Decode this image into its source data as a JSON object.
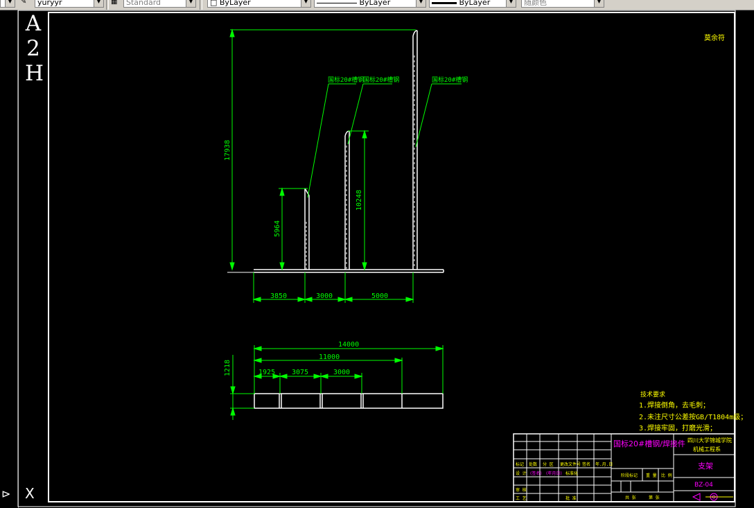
{
  "toolbar": {
    "layer_value": "yuryyr",
    "style_value": "Standard",
    "color_value": "ByLayer",
    "linetype_value": "ByLayer",
    "lineweight_value": "ByLayer",
    "plotstyle_value": "随颜色"
  },
  "sheet": {
    "side_letters": [
      "A",
      "2",
      "H"
    ],
    "bottom_mark": "X",
    "corner_note": "莫余符"
  },
  "elevation_view": {
    "leader_labels": [
      "国标20#槽钢",
      "国标20#槽钢",
      "国标20#槽钢"
    ],
    "dim_total_height": "17938",
    "dim_left_height": "5964",
    "dim_mid_height": "10248",
    "dim_spacing_1": "3850",
    "dim_spacing_2": "3000",
    "dim_spacing_3": "5000"
  },
  "plan_view": {
    "dim_overall": "14000",
    "dim_inner": "11000",
    "dim_a": "1925",
    "dim_b": "3075",
    "dim_c": "3000",
    "dim_depth": "1218"
  },
  "notes": {
    "title": "技术要求",
    "line1": "1.焊接倒角，去毛刺；",
    "line2": "2.未注尺寸公差按GB/T1804m级；",
    "line3": "3.焊接牢固，打磨光滑；"
  },
  "title_block": {
    "material": "国标20#槽钢/焊接件",
    "school_line1": "四川大学锦城学院",
    "school_line2": "机械工程系",
    "part_name": "支架",
    "drawing_no": "BZ-04",
    "row_labels_1": [
      "标记",
      "处数",
      "分 区",
      "更改文件号",
      "签名",
      "年.月.日"
    ],
    "row_labels_2": [
      "设 计",
      "(签名)",
      "(年月日)",
      "标准化"
    ],
    "row_labels_3": [
      "审 核"
    ],
    "row_labels_4": [
      "工 艺",
      "批 准"
    ],
    "stage_labels": [
      "阶段标记",
      "重 量",
      "比 例"
    ],
    "sheet_labels": [
      "共 张",
      "第 张"
    ]
  },
  "colors": {
    "dimension": "#00ff00",
    "outline": "#ffffff",
    "notes": "#ffff00",
    "title_material": "#ff00ff",
    "background": "#000000"
  }
}
